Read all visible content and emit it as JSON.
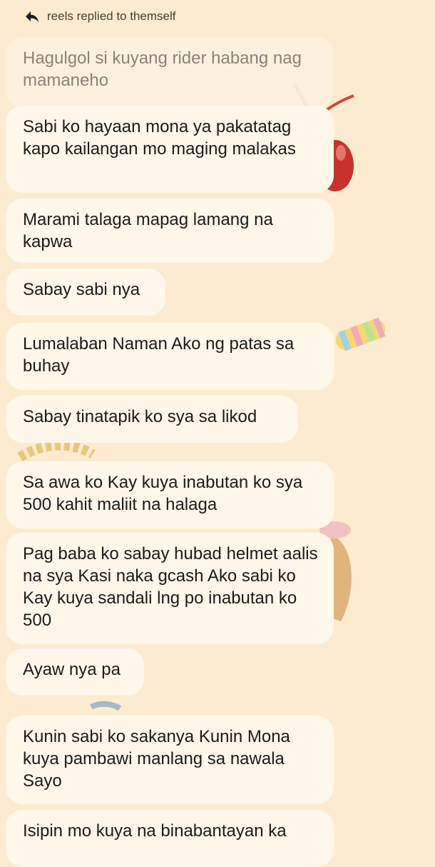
{
  "reply_header": {
    "text": "reels replied to themself",
    "icon": "reply-arrow-icon"
  },
  "quoted_message": "Hagulgol si kuyang rider habang nag mamaneho",
  "messages": [
    "Sabi ko hayaan mona ya pakatatag kapo kailangan mo maging malakas",
    "Marami talaga mapag lamang na kapwa",
    "Sabay sabi nya",
    "Lumalaban Naman Ako ng patas sa buhay",
    "Sabay tinatapik ko sya sa likod",
    "Sa awa ko Kay kuya inabutan ko sya 500 kahit maliit na halaga",
    "Pag baba ko sabay hubad helmet aalis na sya Kasi naka gcash Ako sabi ko Kay kuya sandali lng po inabutan ko 500",
    "Ayaw nya pa",
    "Kunin sabi ko sakanya Kunin Mona kuya pambawi manlang sa nawala Sayo",
    "Isipin mo kuya na binabantayan ka"
  ],
  "colors": {
    "background": "#fdebcf",
    "bubble": "#fff7ea",
    "quoted_text": "#8b8178",
    "text": "#1c1b1a"
  }
}
